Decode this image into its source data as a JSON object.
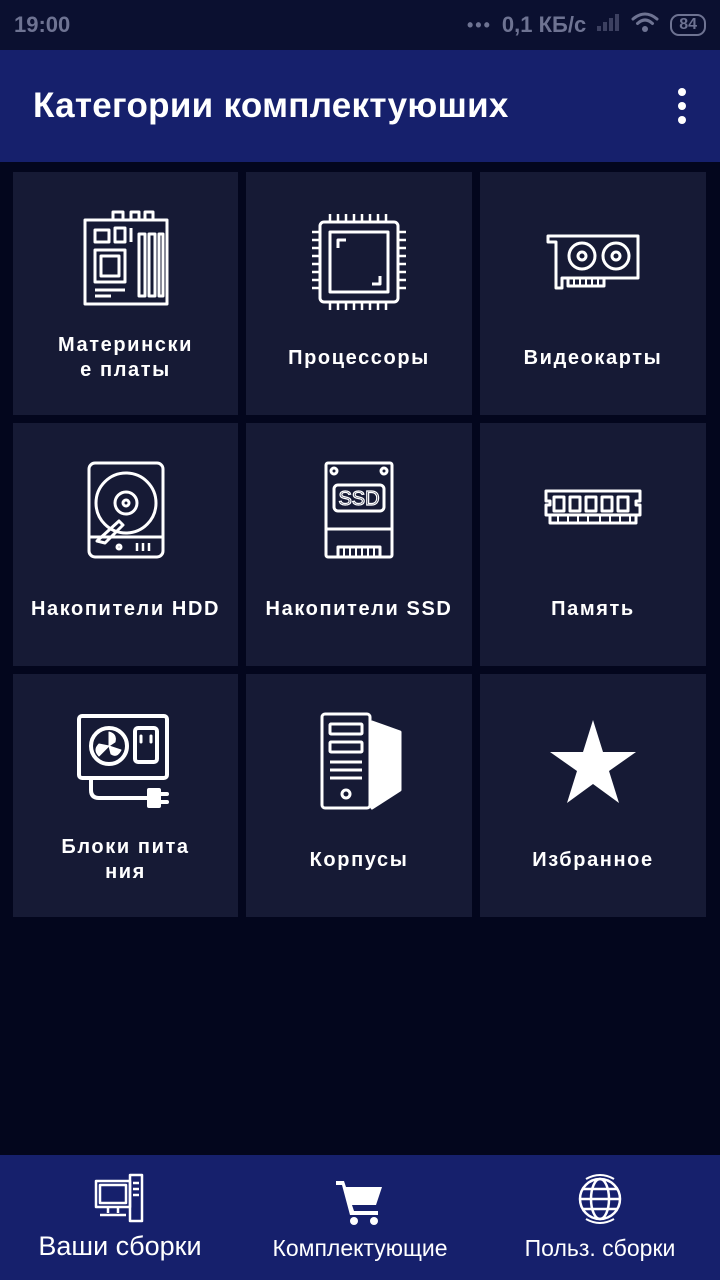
{
  "status_bar": {
    "time": "19:00",
    "network_speed": "0,1 КБ/с",
    "battery": "84"
  },
  "app_bar": {
    "title": "Категории комплектуюших"
  },
  "categories": [
    {
      "label": "Материнские платы",
      "icon": "motherboard-icon"
    },
    {
      "label": "Процессоры",
      "icon": "cpu-icon"
    },
    {
      "label": "Видеокарты",
      "icon": "gpu-icon"
    },
    {
      "label": "Накопители HDD",
      "icon": "hdd-icon"
    },
    {
      "label": "Накопители SSD",
      "icon": "ssd-icon"
    },
    {
      "label": "Память",
      "icon": "ram-icon"
    },
    {
      "label": "Блоки питания",
      "icon": "psu-icon"
    },
    {
      "label": "Корпусы",
      "icon": "pc-case-icon"
    },
    {
      "label": "Избранное",
      "icon": "star-icon"
    }
  ],
  "bottom_nav": [
    {
      "label": "Ваши сборки",
      "icon": "computer-icon"
    },
    {
      "label": "Комплектующие",
      "icon": "cart-icon"
    },
    {
      "label": "Польз. сборки",
      "icon": "globe-icon"
    }
  ],
  "colors": {
    "background": "#03061d",
    "app_bar": "#16206c",
    "tile": "#161a35",
    "text": "#ffffff"
  }
}
